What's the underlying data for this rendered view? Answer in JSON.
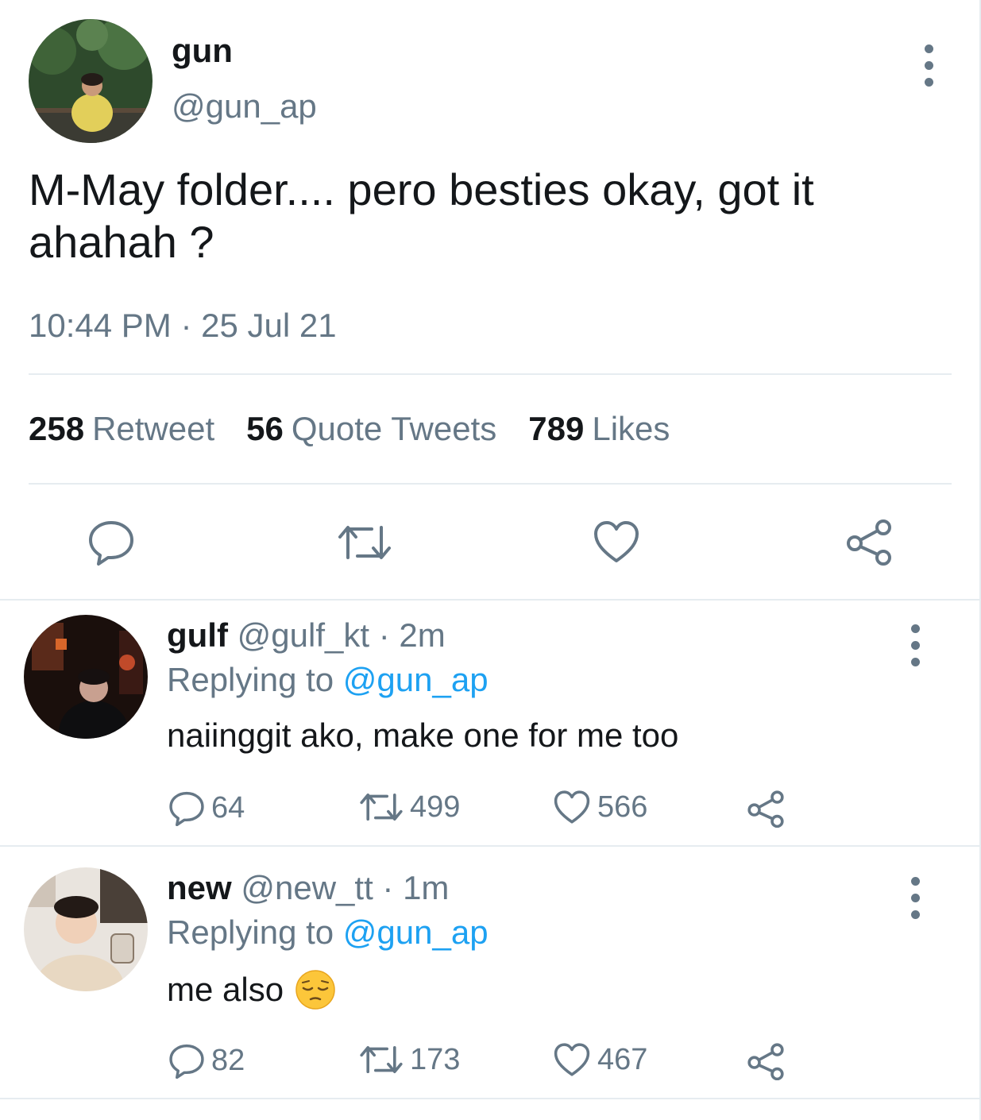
{
  "tweet": {
    "author_name": "gun",
    "author_handle": "@gun_ap",
    "text": "M-May folder.... pero besties okay, got it ahahah ?",
    "timestamp": "10:44 PM · 25 Jul 21",
    "stats": [
      {
        "count": "258",
        "label": "Retweet"
      },
      {
        "count": "56",
        "label": "Quote Tweets"
      },
      {
        "count": "789",
        "label": "Likes"
      }
    ],
    "actions": [
      "reply-icon",
      "retweet-icon",
      "like-icon",
      "share-icon"
    ]
  },
  "replies": [
    {
      "name": "gulf",
      "handle": "@gulf_kt",
      "time": "· 2m",
      "replying_label": "Replying to",
      "replying_to": "@gun_ap",
      "text": "naiinggit ako, make one for me too",
      "replies": "64",
      "retweets": "499",
      "likes": "566"
    },
    {
      "name": "new",
      "handle": "@new_tt",
      "time": "· 1m",
      "replying_label": "Replying to",
      "replying_to": "@gun_ap",
      "text": "me also",
      "emoji": "pensive-face-emoji",
      "replies": "82",
      "retweets": "173",
      "likes": "467"
    }
  ],
  "colors": {
    "text": "#14171a",
    "secondary": "#657786",
    "link": "#1da1f2",
    "divider": "#e6ecf0"
  }
}
